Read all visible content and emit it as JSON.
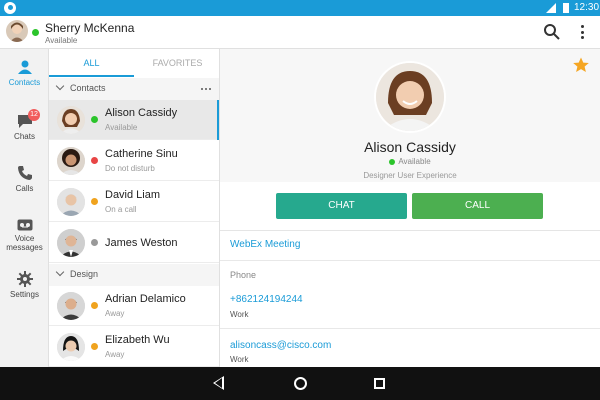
{
  "status_bar": {
    "time": "12:30"
  },
  "header": {
    "user_name": "Sherry McKenna",
    "user_status": "Available"
  },
  "nav": [
    {
      "label": "Contacts",
      "icon": "person-icon",
      "active": true
    },
    {
      "label": "Chats",
      "icon": "chat-icon",
      "badge": "12"
    },
    {
      "label": "Calls",
      "icon": "phone-icon"
    },
    {
      "label": "Voice\nmessages",
      "label_line1": "Voice",
      "label_line2": "messages",
      "icon": "voicemail-icon"
    },
    {
      "label": "Settings",
      "icon": "gear-icon"
    }
  ],
  "tabs": {
    "all": "ALL",
    "favorites": "FAVORITES"
  },
  "groups": [
    {
      "name": "Contacts",
      "contacts": [
        {
          "name": "Alison Cassidy",
          "status": "Available",
          "color": "#2bc42b",
          "selected": true
        },
        {
          "name": "Catherine Sinu",
          "status": "Do not disturb",
          "color": "#e84545"
        },
        {
          "name": "David Liam",
          "status": "On a call",
          "color": "#f0a31e"
        },
        {
          "name": "James Weston",
          "status": "",
          "color": "#999999"
        }
      ]
    },
    {
      "name": "Design",
      "contacts": [
        {
          "name": "Adrian Delamico",
          "status": "Away",
          "color": "#f0a31e"
        },
        {
          "name": "Elizabeth Wu",
          "status": "Away",
          "color": "#f0a31e"
        }
      ]
    }
  ],
  "detail": {
    "name": "Alison Cassidy",
    "status": "Available",
    "title": "Designer User Experience",
    "chat_label": "CHAT",
    "call_label": "CALL",
    "webex_label": "WebEx Meeting",
    "phone_header": "Phone",
    "phone": "+862124194244",
    "phone_type": "Work",
    "email": "alisoncass@cisco.com",
    "email_type": "Work"
  },
  "colors": {
    "accent": "#1a9bd7",
    "chat": "#26a98e",
    "call": "#4caf50",
    "star": "#f5a623"
  }
}
